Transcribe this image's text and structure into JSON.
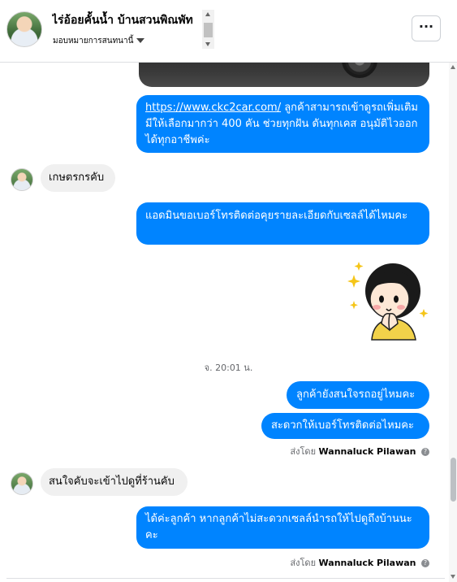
{
  "header": {
    "contact_name": "ไร่อ้อยคั้นน้ำ บ้านสวนพิณพัท",
    "assignee_text": "มอบหมายการสนทนานี้",
    "more_label": "···"
  },
  "messages": {
    "out_1": {
      "link": "https://www.ckc2car.com/",
      "text": " ลูกค้าสามารถเข้าดูรถเพิ่มเติมมีให้เลือกมากว่า 400 คัน ช่วยทุกฝัน ดันทุกเคส อนุมัติไวออกได้ทุกอาชีพค่ะ"
    },
    "in_1": "เกษตรกรคับ",
    "out_2": "แอดมินขอเบอร์โทรติดต่อคุยรายละเอียดกับเซลล์ได้ไหมคะ",
    "timestamp": "จ. 20:01 น.",
    "out_3": "ลูกค้ายังสนใจรถอยู่ไหมคะ",
    "out_4": "สะดวกให้เบอร์โทรติดต่อไหมคะ",
    "sent_by_prefix": "ส่งโดย",
    "sender_name": "Wannaluck Pilawan",
    "info_glyph": "?",
    "in_2": "สนใจคับจะเข้าไปดูที่ร้านคับ",
    "out_5": "ได้ค่ะลูกค้า หากลูกค้าไม่สะดวกเซลล์นำรถให้ไปดูถึงบ้านนะคะ"
  },
  "colors": {
    "outgoing_bubble": "#0084ff",
    "incoming_bubble": "#f0f0f0",
    "meta_text": "#65676b"
  },
  "icons": {
    "more": "more-dots-icon",
    "caret": "caret-down-icon",
    "info": "info-icon",
    "sticker": "girl-sticker-icon"
  }
}
